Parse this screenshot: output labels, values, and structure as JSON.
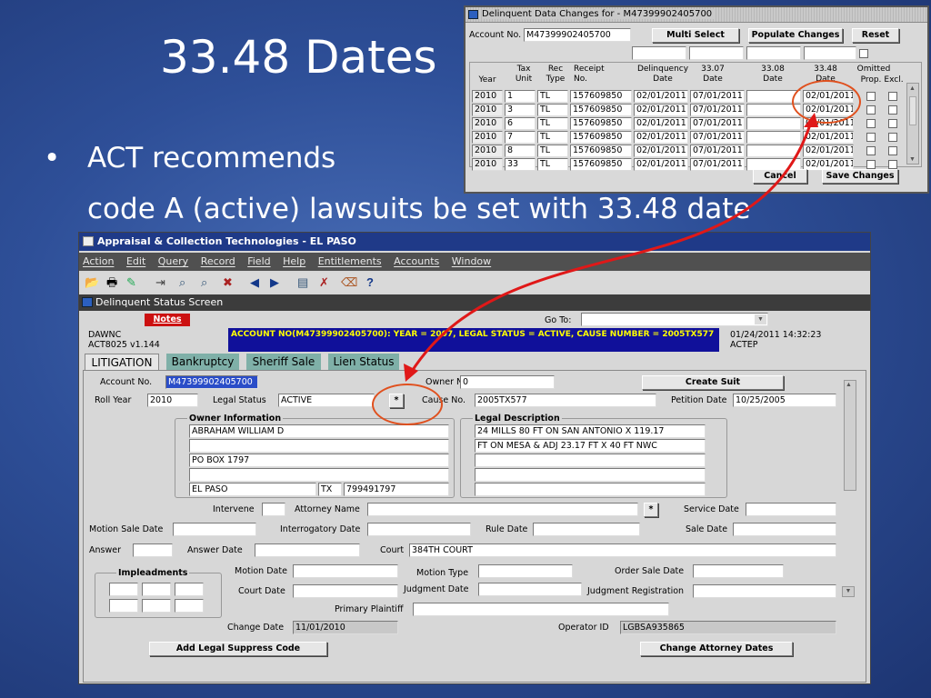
{
  "slide": {
    "title": "33.48 Dates",
    "bullet": "•",
    "line1": "ACT recommends",
    "line2": "code A (active) lawsuits be set with 33.48 date"
  },
  "popup": {
    "title": "Delinquent Data Changes for - M47399902405700",
    "account_label": "Account No.",
    "account_value": "M47399902405700",
    "multi_select": "Multi Select",
    "populate_changes": "Populate Changes",
    "reset": "Reset",
    "headers": {
      "year": "Year",
      "tax_unit": "Tax Unit",
      "rec_type": "Rec Type",
      "receipt_no": "Receipt No.",
      "delinquency_date": "Delinquency Date",
      "d3307": "33.07 Date",
      "d3308": "33.08 Date",
      "d3348": "33.48 Date",
      "omitted": "Omitted",
      "prop": "Prop.",
      "excl": "Excl."
    },
    "rows": [
      {
        "year": "2010",
        "unit": "1",
        "type": "TL",
        "receipt": "157609850",
        "delinq": "02/01/2011",
        "d3307": "07/01/2011",
        "d3308": "",
        "d3348": "02/01/2011"
      },
      {
        "year": "2010",
        "unit": "3",
        "type": "TL",
        "receipt": "157609850",
        "delinq": "02/01/2011",
        "d3307": "07/01/2011",
        "d3308": "",
        "d3348": "02/01/2011"
      },
      {
        "year": "2010",
        "unit": "6",
        "type": "TL",
        "receipt": "157609850",
        "delinq": "02/01/2011",
        "d3307": "07/01/2011",
        "d3308": "",
        "d3348": "02/01/2011"
      },
      {
        "year": "2010",
        "unit": "7",
        "type": "TL",
        "receipt": "157609850",
        "delinq": "02/01/2011",
        "d3307": "07/01/2011",
        "d3308": "",
        "d3348": "02/01/2011"
      },
      {
        "year": "2010",
        "unit": "8",
        "type": "TL",
        "receipt": "157609850",
        "delinq": "02/01/2011",
        "d3307": "07/01/2011",
        "d3308": "",
        "d3348": "02/01/2011"
      },
      {
        "year": "2010",
        "unit": "33",
        "type": "TL",
        "receipt": "157609850",
        "delinq": "02/01/2011",
        "d3307": "07/01/2011",
        "d3308": "",
        "d3348": "02/01/2011"
      }
    ],
    "cancel": "Cancel",
    "save_changes": "Save Changes"
  },
  "app": {
    "title": "Appraisal & Collection Technologies - EL PASO",
    "menu": [
      "Action",
      "Edit",
      "Query",
      "Record",
      "Field",
      "Help",
      "Entitlements",
      "Accounts",
      "Window"
    ],
    "screen_title": "Delinquent Status Screen",
    "notes": "Notes",
    "goto_label": "Go To:",
    "dawnc": "DAWNC",
    "form_id": "ACT8025  v1.144",
    "banner": "ACCOUNT NO(M47399902405700): YEAR = 2007,  LEGAL STATUS = ACTIVE,  CAUSE NUMBER = 2005TX577",
    "datetime": "01/24/2011 14:32:23",
    "user": "ACTEP",
    "tabs": [
      "LITIGATION",
      "Bankruptcy",
      "Sheriff Sale",
      "Lien Status"
    ],
    "fields": {
      "account_no_label": "Account No.",
      "account_no": "M47399902405700",
      "owner_no_label": "Owner No.",
      "owner_no": "0",
      "create_suit": "Create Suit",
      "roll_year_label": "Roll Year",
      "roll_year": "2010",
      "legal_status_label": "Legal Status",
      "legal_status": "ACTIVE",
      "lov": "*",
      "cause_no_label": "Cause No.",
      "cause_no": "2005TX577",
      "petition_date_label": "Petition Date",
      "petition_date": "10/25/2005",
      "owner_info_title": "Owner Information",
      "owner_line1": "ABRAHAM WILLIAM D",
      "owner_line2": "",
      "owner_line3": "PO BOX 1797",
      "owner_line4": "",
      "owner_city": "EL PASO",
      "owner_state": "TX",
      "owner_zip": "799491797",
      "legal_desc_title": "Legal Description",
      "legal_line1": "24 MILLS 80 FT ON SAN ANTONIO X 119.17",
      "legal_line2": "FT ON MESA & ADJ 23.17 FT X 40 FT NWC",
      "intervene_label": "Intervene",
      "attorney_name_label": "Attorney Name",
      "service_date_label": "Service Date",
      "motion_sale_date_label": "Motion Sale Date",
      "interrogatory_date_label": "Interrogatory Date",
      "rule_date_label": "Rule Date",
      "sale_date_label": "Sale Date",
      "answer_label": "Answer",
      "answer_date_label": "Answer Date",
      "court_label": "Court",
      "court": "384TH COURT",
      "impleadments_title": "Impleadments",
      "motion_date_label": "Motion Date",
      "motion_type_label": "Motion Type",
      "order_sale_date_label": "Order Sale Date",
      "court_date_label": "Court Date",
      "judgment_date_label": "Judgment Date",
      "judgment_registration_label": "Judgment Registration",
      "primary_plaintiff_label": "Primary Plaintiff",
      "change_date_label": "Change Date",
      "change_date": "11/01/2010",
      "operator_id_label": "Operator ID",
      "operator_id": "LGBSA935865",
      "add_legal_suppress": "Add Legal Suppress Code",
      "change_attorney_dates": "Change Attorney Dates"
    }
  },
  "colors": {
    "highlight_circle": "#e0501e",
    "arrow": "#e01818",
    "notes_btn": "#cc1111",
    "banner_bg": "#10109a",
    "banner_text": "#ffff00"
  }
}
